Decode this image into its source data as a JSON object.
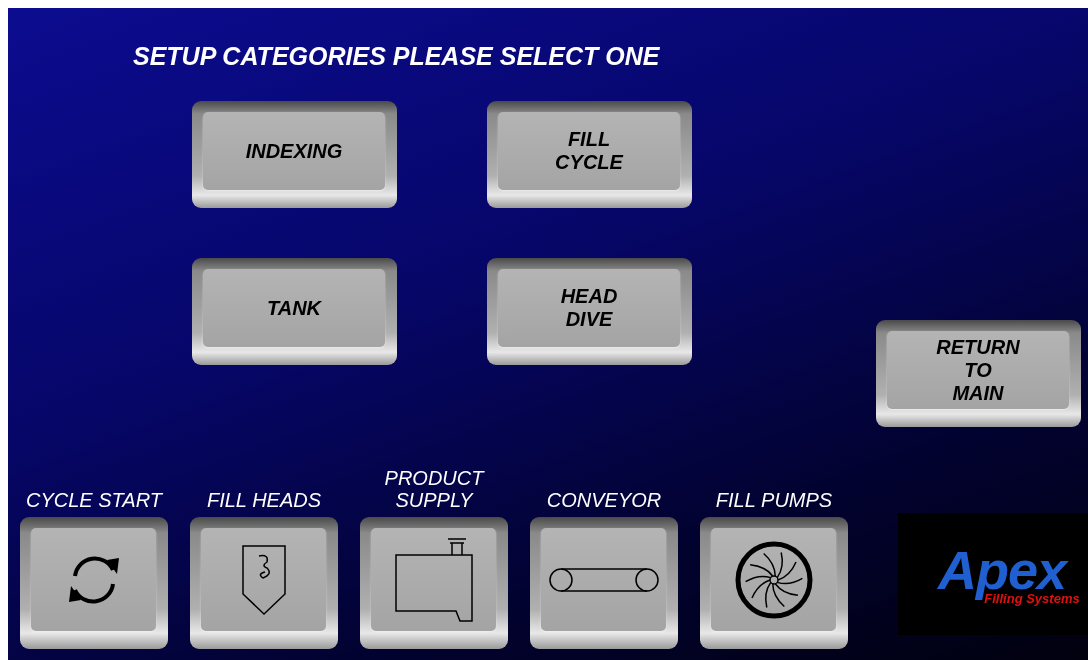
{
  "title": "SETUP CATEGORIES PLEASE SELECT ONE",
  "categories": [
    {
      "lines": [
        "INDEXING"
      ]
    },
    {
      "lines": [
        "FILL",
        "CYCLE"
      ]
    },
    {
      "lines": [
        "TANK"
      ]
    },
    {
      "lines": [
        "HEAD",
        "DIVE"
      ]
    }
  ],
  "return_button": {
    "lines": [
      "RETURN",
      "TO",
      "MAIN"
    ]
  },
  "toolbar": [
    {
      "label": [
        "CYCLE START"
      ],
      "kind": "cycle"
    },
    {
      "label": [
        "FILL HEADS"
      ],
      "kind": "nozzle"
    },
    {
      "label": [
        "PRODUCT",
        "SUPPLY"
      ],
      "kind": "tank"
    },
    {
      "label": [
        "CONVEYOR"
      ],
      "kind": "conveyor"
    },
    {
      "label": [
        "FILL PUMPS"
      ],
      "kind": "pump"
    }
  ],
  "logo": {
    "name": "Apex",
    "tagline": "Filling Systems"
  }
}
